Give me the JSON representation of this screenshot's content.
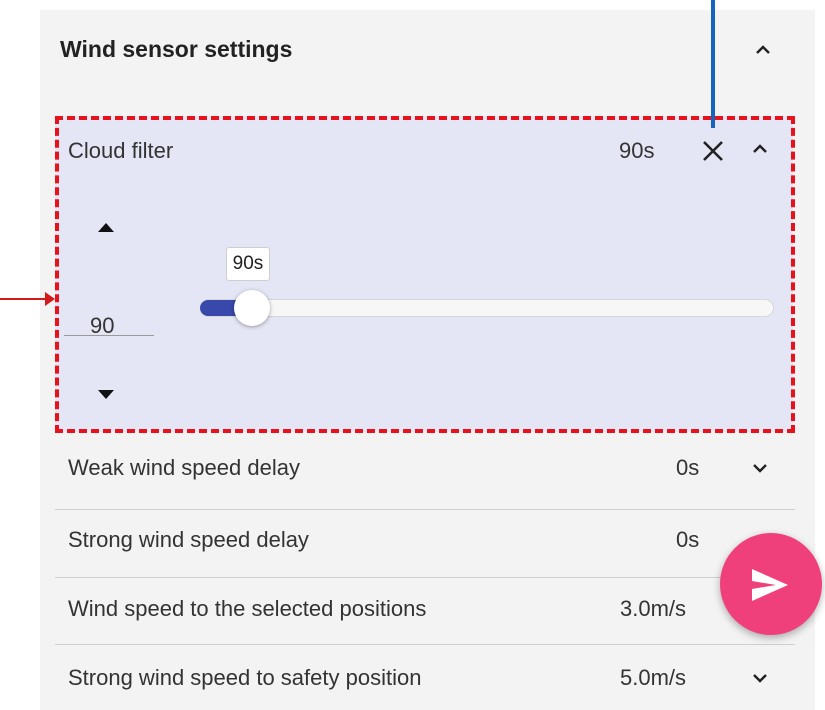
{
  "section": {
    "title": "Wind sensor settings"
  },
  "cloud_filter": {
    "label": "Cloud filter",
    "value": "90s",
    "spinner_value": "90",
    "slider_tooltip": "90s",
    "slider_fraction": 0.09
  },
  "settings_rows": [
    {
      "label": "Weak wind speed delay",
      "value": "0s"
    },
    {
      "label": "Strong wind speed delay",
      "value": "0s"
    },
    {
      "label": "Wind speed to the selected positions",
      "value": "3.0m/s"
    },
    {
      "label": "Strong wind speed to safety position",
      "value": "5.0m/s"
    }
  ],
  "colors": {
    "panel_bg": "#f3f3f3",
    "expanded_bg": "#e5e6f5",
    "slider_fill": "#3949ab",
    "fab_bg": "#f0407b",
    "highlight_dash": "#e8121b",
    "annotation_blue": "#1565c0",
    "annotation_red": "#d11a1a"
  },
  "icons": {
    "section_toggle": "chevron-up-icon",
    "clear": "close-icon",
    "row_expand": "chevron-down-icon",
    "fab": "send-icon"
  }
}
